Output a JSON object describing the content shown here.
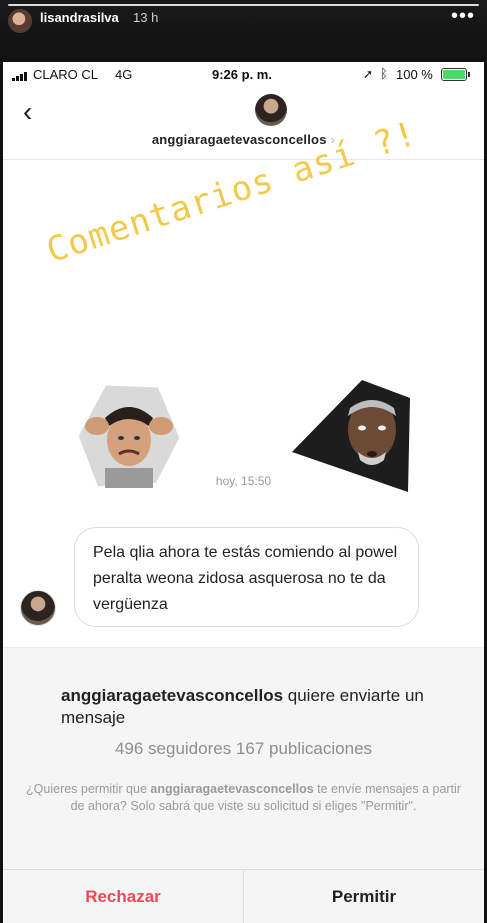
{
  "story": {
    "username": "lisandrasilva",
    "time_ago": "13 h",
    "more_icon": "three-dots-icon"
  },
  "status_bar": {
    "carrier": "CLARO CL",
    "network": "4G",
    "time": "9:26 p. m.",
    "battery": "100 %",
    "battery_level": 1.0
  },
  "header": {
    "back_icon": "chevron-left-icon",
    "username": "anggiaragaetevasconcellos",
    "chevron": "›"
  },
  "overlay_text": "Comentarios así ?!",
  "timestamp": "hoy, 15:50",
  "message": {
    "text": "Pela qlia ahora te estás comiendo al powel peralta weona zidosa asquerosa no te da vergüenza"
  },
  "request": {
    "username": "anggiaragaetevasconcellos",
    "line_text": " quiere enviarte un mensaje",
    "counts": "496 seguidores 167 publicaciones",
    "note_prefix": "¿Quieres permitir que ",
    "note_username": "anggiaragaetevasconcellos",
    "note_suffix": " te envíe mensajes a partir de ahora? Solo sabrá que viste su solicitud si eliges \"Permitir\".",
    "reject_label": "Rechazar",
    "accept_label": "Permitir"
  },
  "colors": {
    "overlay": "#f3c94a",
    "reject": "#ed4956",
    "battery": "#4cd964"
  }
}
